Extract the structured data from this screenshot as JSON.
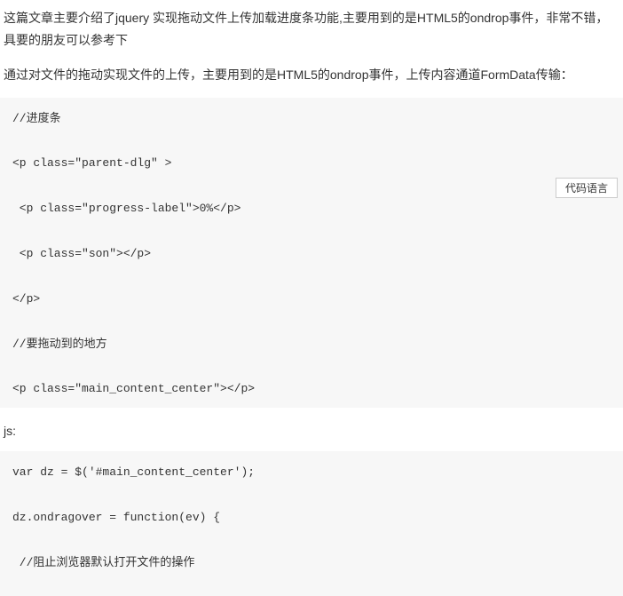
{
  "intro": "这篇文章主要介绍了jquery 实现拖动文件上传加载进度条功能,主要用到的是HTML5的ondrop事件，非常不错，具要的朋友可以参考下",
  "description": "通过对文件的拖动实现文件的上传，主要用到的是HTML5的ondrop事件，上传内容通道FormData传输：",
  "codeLang": "代码语言",
  "codeBlock1": {
    "line1": "//进度条",
    "line2": "<p class=\"parent-dlg\" >",
    "line3": " <p class=\"progress-label\">0%</p>",
    "line4": " <p class=\"son\"></p>",
    "line5": "</p>",
    "line6": "//要拖动到的地方",
    "line7": "<p class=\"main_content_center\"></p>"
  },
  "jsLabel": "js:",
  "codeBlock2": {
    "line1": "var dz = $('#main_content_center');",
    "line2": "dz.ondragover = function(ev) {",
    "line3": " //阻止浏览器默认打开文件的操作"
  }
}
